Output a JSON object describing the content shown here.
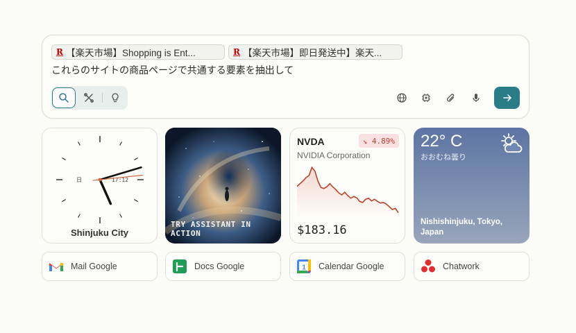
{
  "tabs": [
    {
      "icon": "R",
      "label": "【楽天市場】Shopping is Ent..."
    },
    {
      "icon": "R",
      "label": "【楽天市場】即日発送中】楽天..."
    }
  ],
  "prompt": "これらのサイトの商品ページで共通する要素を抽出して",
  "modes": [
    {
      "name": "search-icon",
      "active": true
    },
    {
      "name": "tools-icon",
      "active": false
    },
    {
      "name": "lightbulb-icon",
      "active": false
    }
  ],
  "tools": [
    "globe-icon",
    "chip-icon",
    "paperclip-icon",
    "microphone-icon"
  ],
  "send": {
    "icon": "arrow-right-icon"
  },
  "clock": {
    "city": "Shinjuku City",
    "day": "日",
    "digital": "17:12",
    "hour": 5,
    "minute": 12,
    "second": 14
  },
  "assistant_card": {
    "caption": "TRY ASSISTANT IN ACTION"
  },
  "stock": {
    "ticker": "NVDA",
    "name": "NVIDIA Corporation",
    "change": "↘ 4.89%",
    "price": "$183.16",
    "color": "#b8432b",
    "series": [
      188,
      188.5,
      189,
      189.6,
      190,
      191.5,
      190.8,
      189,
      187.8,
      187.6,
      187.9,
      188.5,
      187.9,
      187.4,
      186.8,
      186.4,
      186.9,
      186.3,
      185.8,
      186.1,
      185.9,
      185.2,
      185,
      185.6,
      185.8,
      185.3,
      185.6,
      185.2,
      184.9,
      185,
      184.7,
      184.2,
      183.7,
      183.9,
      183.1
    ]
  },
  "weather": {
    "temp": "22° C",
    "desc": "おおむね曇り",
    "location": "Nishishinjuku, Tokyo, Japan",
    "icon": "partly-cloudy-icon"
  },
  "shortcuts": [
    {
      "name": "mail-google",
      "icon": "gmail-icon",
      "label": "Mail Google"
    },
    {
      "name": "docs-google",
      "icon": "google-sheets-icon",
      "label": "Docs Google"
    },
    {
      "name": "calendar-google",
      "icon": "google-calendar-icon",
      "label": "Calendar Google"
    },
    {
      "name": "chatwork",
      "icon": "chatwork-icon",
      "label": "Chatwork"
    }
  ],
  "colors": {
    "accent": "#2a7c87",
    "stock_down": "#c63b35",
    "rakuten": "#bf0000"
  }
}
